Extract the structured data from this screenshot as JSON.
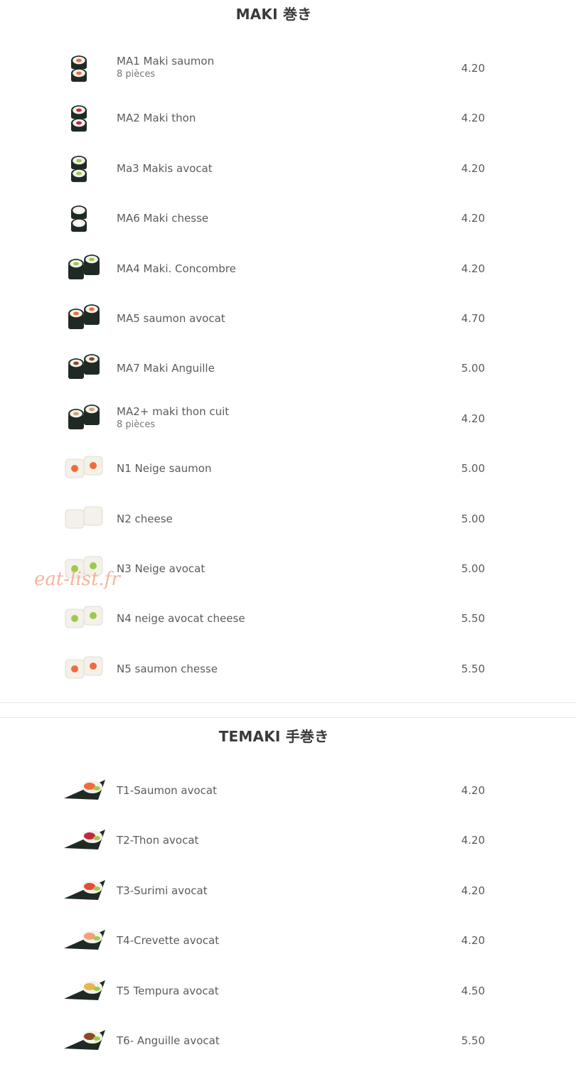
{
  "sections": [
    {
      "title": "MAKI 巻き",
      "items": [
        {
          "name": "MA1 Maki saumon",
          "desc": "8 pièces",
          "price": "4.20",
          "thumb": "maki-salmon"
        },
        {
          "name": "MA2 Maki thon",
          "desc": "",
          "price": "4.20",
          "thumb": "maki-tuna"
        },
        {
          "name": "Ma3 Makis avocat",
          "desc": "",
          "price": "4.20",
          "thumb": "maki-avocado"
        },
        {
          "name": "MA6 Maki chesse",
          "desc": "",
          "price": "4.20",
          "thumb": "maki-cheese"
        },
        {
          "name": "MA4 Maki. Concombre",
          "desc": "",
          "price": "4.20",
          "thumb": "maki-cucumber"
        },
        {
          "name": "MA5 saumon avocat",
          "desc": "",
          "price": "4.70",
          "thumb": "maki-salmon-avocado"
        },
        {
          "name": "MA7 Maki Anguille",
          "desc": "",
          "price": "5.00",
          "thumb": "maki-eel"
        },
        {
          "name": "MA2+ maki thon cuit",
          "desc": "8 pièces",
          "price": "4.20",
          "thumb": "maki-cooked-tuna"
        },
        {
          "name": "N1 Neige saumon",
          "desc": "",
          "price": "5.00",
          "thumb": "neige-salmon"
        },
        {
          "name": "N2 cheese",
          "desc": "",
          "price": "5.00",
          "thumb": "neige-cheese"
        },
        {
          "name": "N3 Neige avocat",
          "desc": "",
          "price": "5.00",
          "thumb": "neige-avocado"
        },
        {
          "name": "N4 neige avocat cheese",
          "desc": "",
          "price": "5.50",
          "thumb": "neige-avocado-cheese"
        },
        {
          "name": "N5 saumon chesse",
          "desc": "",
          "price": "5.50",
          "thumb": "neige-salmon-cheese"
        }
      ]
    },
    {
      "title": "TEMAKI 手巻き",
      "items": [
        {
          "name": "T1-Saumon avocat",
          "desc": "",
          "price": "4.20",
          "thumb": "temaki-salmon"
        },
        {
          "name": "T2-Thon avocat",
          "desc": "",
          "price": "4.20",
          "thumb": "temaki-tuna"
        },
        {
          "name": "T3-Surimi avocat",
          "desc": "",
          "price": "4.20",
          "thumb": "temaki-surimi"
        },
        {
          "name": "T4-Crevette avocat",
          "desc": "",
          "price": "4.20",
          "thumb": "temaki-shrimp"
        },
        {
          "name": "T5 Tempura avocat",
          "desc": "",
          "price": "4.50",
          "thumb": "temaki-tempura"
        },
        {
          "name": "T6- Anguille avocat",
          "desc": "",
          "price": "5.50",
          "thumb": "temaki-eel"
        }
      ]
    }
  ],
  "watermark": "eat-list.fr",
  "colors": {
    "text": "#5b5b5b",
    "title": "#3a3a3a",
    "watermark": "#f2a98d",
    "nori": "#1f2a24",
    "rice": "#f4f1ea",
    "salmon": "#f26b3a",
    "tuna": "#c0283e",
    "avocado": "#9ccb4a",
    "eel": "#8a4a2a"
  }
}
